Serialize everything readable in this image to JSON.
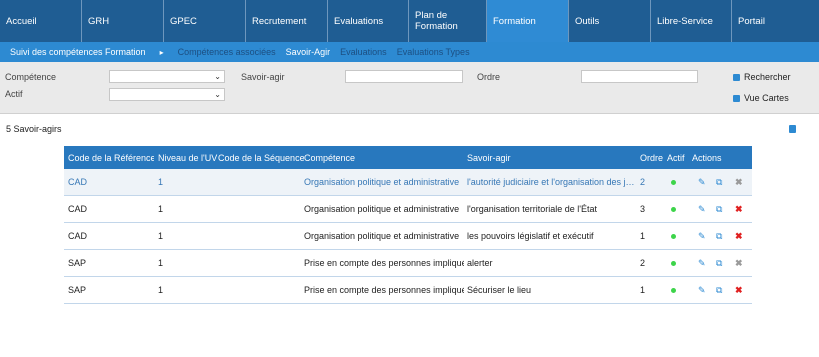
{
  "topnav": {
    "tabs": [
      {
        "label": "Accueil"
      },
      {
        "label": "GRH"
      },
      {
        "label": "GPEC"
      },
      {
        "label": "Recrutement"
      },
      {
        "label": "Evaluations"
      },
      {
        "label": "Plan de Formation"
      },
      {
        "label": "Formation",
        "active": true
      },
      {
        "label": "Outils"
      },
      {
        "label": "Libre-Service"
      },
      {
        "label": "Portail"
      }
    ]
  },
  "subnav": {
    "current": "Suivi des compétences Formation",
    "separator": "▸",
    "items": [
      "Compétences associées",
      "Savoir-Agir",
      "Evaluations",
      "Evaluations Types"
    ]
  },
  "filters": {
    "competence_label": "Compétence",
    "competence_value": "",
    "actif_label": "Actif",
    "actif_value": "",
    "savoir_agir_label": "Savoir-agir",
    "savoir_agir_value": "",
    "ordre_label": "Ordre",
    "ordre_value": "",
    "search_button": "Rechercher",
    "cards_button": "Vue Cartes"
  },
  "results": {
    "count_text": "5 Savoir-agirs"
  },
  "table": {
    "headers": [
      "Code de la Référence",
      "Niveau de l'UV",
      "Code de la Séquence",
      "Compétence",
      "Savoir-agir",
      "Ordre",
      "Actif",
      "Actions"
    ],
    "rows": [
      {
        "ref": "CAD",
        "niveau": "1",
        "sequence": "",
        "competence": "Organisation politique et administrative",
        "savoir_agir": "l'autorité judiciaire et l'organisation des juridictions",
        "ordre": "2",
        "actif": true,
        "deletable": false,
        "highlight": true
      },
      {
        "ref": "CAD",
        "niveau": "1",
        "sequence": "",
        "competence": "Organisation politique et administrative",
        "savoir_agir": "l'organisation territoriale de l'État",
        "ordre": "3",
        "actif": true,
        "deletable": true,
        "highlight": false
      },
      {
        "ref": "CAD",
        "niveau": "1",
        "sequence": "",
        "competence": "Organisation politique et administrative",
        "savoir_agir": "les pouvoirs législatif et exécutif",
        "ordre": "1",
        "actif": true,
        "deletable": true,
        "highlight": false
      },
      {
        "ref": "SAP",
        "niveau": "1",
        "sequence": "",
        "competence": "Prise en compte des personnes impliquées",
        "savoir_agir": "alerter",
        "ordre": "2",
        "actif": true,
        "deletable": false,
        "highlight": false
      },
      {
        "ref": "SAP",
        "niveau": "1",
        "sequence": "",
        "competence": "Prise en compte des personnes impliquées",
        "savoir_agir": "Sécuriser le lieu",
        "ordre": "1",
        "actif": true,
        "deletable": true,
        "highlight": false
      }
    ],
    "icons": {
      "edit": "edit-icon",
      "copy": "copy-icon",
      "delete": "delete-icon",
      "active": "active-dot-icon"
    }
  },
  "colors": {
    "nav_bg": "#1f5d93",
    "nav_active": "#2f8bd4",
    "subnav_bg": "#2d8ad2",
    "table_header": "#2878be",
    "active_dot": "#3dd44a",
    "delete_red": "#e02020"
  }
}
